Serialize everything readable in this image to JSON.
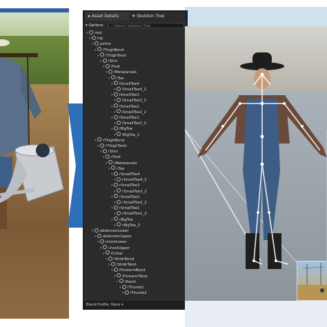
{
  "panel": {
    "tabs": [
      {
        "label": "Asset Details"
      },
      {
        "label": "Skeleton Tree"
      }
    ],
    "toolbar": {
      "options_label": "Options",
      "search_placeholder": "Search Skeleton Tree..."
    },
    "tree": [
      {
        "label": "root",
        "depth": 0
      },
      {
        "label": "hip",
        "depth": 1
      },
      {
        "label": "pelvis",
        "depth": 2
      },
      {
        "label": "lThighBend",
        "depth": 3
      },
      {
        "label": "lThighTwist",
        "depth": 4
      },
      {
        "label": "lShin",
        "depth": 5
      },
      {
        "label": "lFoot",
        "depth": 6
      },
      {
        "label": "lMetatarsals",
        "depth": 7
      },
      {
        "label": "lToe",
        "depth": 8
      },
      {
        "label": "lSmallToe4",
        "depth": 9
      },
      {
        "label": "lSmallToe4_2",
        "depth": 10
      },
      {
        "label": "lSmallToe3",
        "depth": 9
      },
      {
        "label": "lSmallToe3_2",
        "depth": 10
      },
      {
        "label": "lSmallToe2",
        "depth": 9
      },
      {
        "label": "lSmallToe2_2",
        "depth": 10
      },
      {
        "label": "lSmallToe1",
        "depth": 9
      },
      {
        "label": "lSmallToe1_2",
        "depth": 10
      },
      {
        "label": "lBigToe",
        "depth": 9
      },
      {
        "label": "lBigToe_2",
        "depth": 10
      },
      {
        "label": "rThighBend",
        "depth": 3
      },
      {
        "label": "rThighTwist",
        "depth": 4
      },
      {
        "label": "rShin",
        "depth": 5
      },
      {
        "label": "rFoot",
        "depth": 6
      },
      {
        "label": "rMetatarsals",
        "depth": 7
      },
      {
        "label": "rToe",
        "depth": 8
      },
      {
        "label": "rSmallToe4",
        "depth": 9
      },
      {
        "label": "rSmallToe4_2",
        "depth": 10
      },
      {
        "label": "rSmallToe3",
        "depth": 9
      },
      {
        "label": "rSmallToe3_2",
        "depth": 10
      },
      {
        "label": "rSmallToe2",
        "depth": 9
      },
      {
        "label": "rSmallToe2_2",
        "depth": 10
      },
      {
        "label": "rSmallToe1",
        "depth": 9
      },
      {
        "label": "rSmallToe1_2",
        "depth": 10
      },
      {
        "label": "rBigToe",
        "depth": 9
      },
      {
        "label": "rBigToe_2",
        "depth": 10
      },
      {
        "label": "abdomenLower",
        "depth": 2
      },
      {
        "label": "abdomenUpper",
        "depth": 3
      },
      {
        "label": "chestLower",
        "depth": 4
      },
      {
        "label": "chestUpper",
        "depth": 5
      },
      {
        "label": "lCollar",
        "depth": 6
      },
      {
        "label": "lShldrBend",
        "depth": 7
      },
      {
        "label": "lShldrTwist",
        "depth": 8
      },
      {
        "label": "lForearmBend",
        "depth": 9
      },
      {
        "label": "lForearmTwist",
        "depth": 10
      },
      {
        "label": "lHand",
        "depth": 11
      },
      {
        "label": "lThumb1",
        "depth": 12
      },
      {
        "label": "lThumb2",
        "depth": 13
      }
    ],
    "status": {
      "blend_profile": "Blend Profile: None"
    }
  },
  "colors": {
    "panel_bg": "#2b2b2b",
    "accent_blue": "#2f6fb8",
    "text": "#dcdcdc"
  },
  "icons": [
    "bone-icon",
    "expand-icon",
    "options-icon",
    "search-icon"
  ]
}
